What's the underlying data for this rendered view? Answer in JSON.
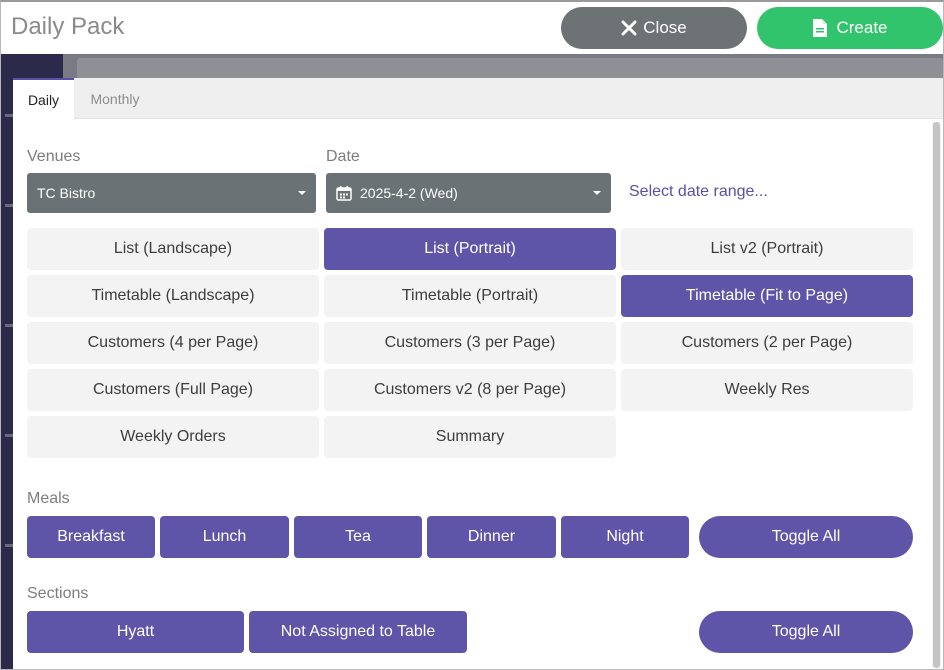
{
  "header": {
    "title": "Daily Pack",
    "close_label": "Close",
    "create_label": "Create"
  },
  "tabs": [
    {
      "label": "Daily",
      "active": true
    },
    {
      "label": "Monthly",
      "active": false
    }
  ],
  "filters": {
    "venues_label": "Venues",
    "venue_value": "TC Bistro",
    "date_label": "Date",
    "date_value": "2025-4-2 (Wed)",
    "date_range_link": "Select date range..."
  },
  "report_types": [
    {
      "label": "List (Landscape)",
      "selected": false
    },
    {
      "label": "List (Portrait)",
      "selected": true
    },
    {
      "label": "List v2 (Portrait)",
      "selected": false
    },
    {
      "label": "Timetable (Landscape)",
      "selected": false
    },
    {
      "label": "Timetable (Portrait)",
      "selected": false
    },
    {
      "label": "Timetable (Fit to Page)",
      "selected": true
    },
    {
      "label": "Customers (4 per Page)",
      "selected": false
    },
    {
      "label": "Customers (3 per Page)",
      "selected": false
    },
    {
      "label": "Customers (2 per Page)",
      "selected": false
    },
    {
      "label": "Customers (Full Page)",
      "selected": false
    },
    {
      "label": "Customers v2 (8 per Page)",
      "selected": false
    },
    {
      "label": "Weekly Res",
      "selected": false
    },
    {
      "label": "Weekly Orders",
      "selected": false
    },
    {
      "label": "Summary",
      "selected": false
    }
  ],
  "meals": {
    "label": "Meals",
    "items": [
      "Breakfast",
      "Lunch",
      "Tea",
      "Dinner",
      "Night"
    ],
    "toggle_all": "Toggle All"
  },
  "sections": {
    "label": "Sections",
    "items": [
      "Hyatt",
      "Not Assigned to Table"
    ],
    "toggle_all": "Toggle All"
  },
  "colors": {
    "accent": "#5f55a8",
    "close": "#6d7275",
    "create": "#31c46c",
    "unselected": "#f3f3f3"
  },
  "icons": {
    "close": "close-x-icon",
    "create": "document-icon",
    "date": "calendar-icon",
    "dropdown": "caret-down-icon"
  }
}
